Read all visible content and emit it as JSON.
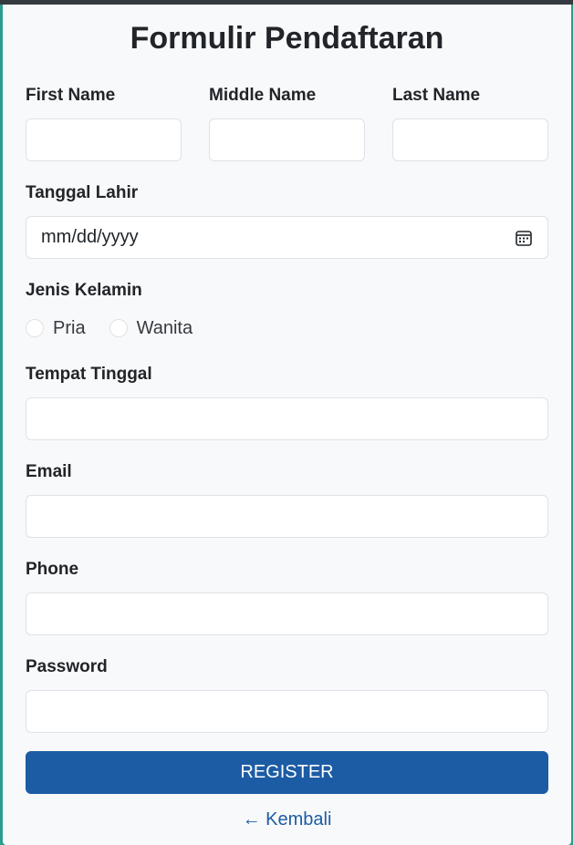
{
  "form": {
    "title": "Formulir Pendaftaran",
    "first_name_label": "First Name",
    "middle_name_label": "Middle Name",
    "last_name_label": "Last Name",
    "dob_label": "Tanggal Lahir",
    "dob_placeholder": "mm/dd/yyyy",
    "gender_label": "Jenis Kelamin",
    "gender_options": [
      "Pria",
      "Wanita"
    ],
    "residence_label": "Tempat Tinggal",
    "email_label": "Email",
    "phone_label": "Phone",
    "password_label": "Password",
    "register_button": "REGISTER",
    "back_link": "← Kembali"
  },
  "colors": {
    "background": "#2a9d8f",
    "card": "#f8f9fa",
    "primary": "#1c5ca4"
  },
  "icons": {
    "date_picker": "calendar-icon"
  }
}
